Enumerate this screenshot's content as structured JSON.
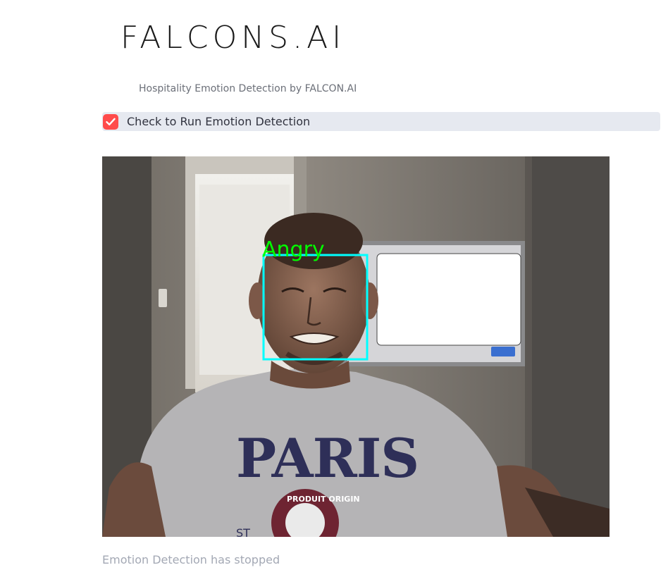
{
  "header": {
    "logo_text": "FALCONS.AI",
    "caption": "Hospitality Emotion Detection by FALCON.AI"
  },
  "controls": {
    "run_checkbox": {
      "label": "Check to Run Emotion Detection",
      "checked": true,
      "accent_color": "#ff4b4b"
    }
  },
  "video": {
    "detected_emotion": "Angry",
    "box_color": "#00ffff",
    "label_color": "#00ff00",
    "shirt_text": "PARIS",
    "shirt_badge_text": "PRODUIT ORIGIN"
  },
  "status": {
    "message": "Emotion Detection has stopped"
  }
}
